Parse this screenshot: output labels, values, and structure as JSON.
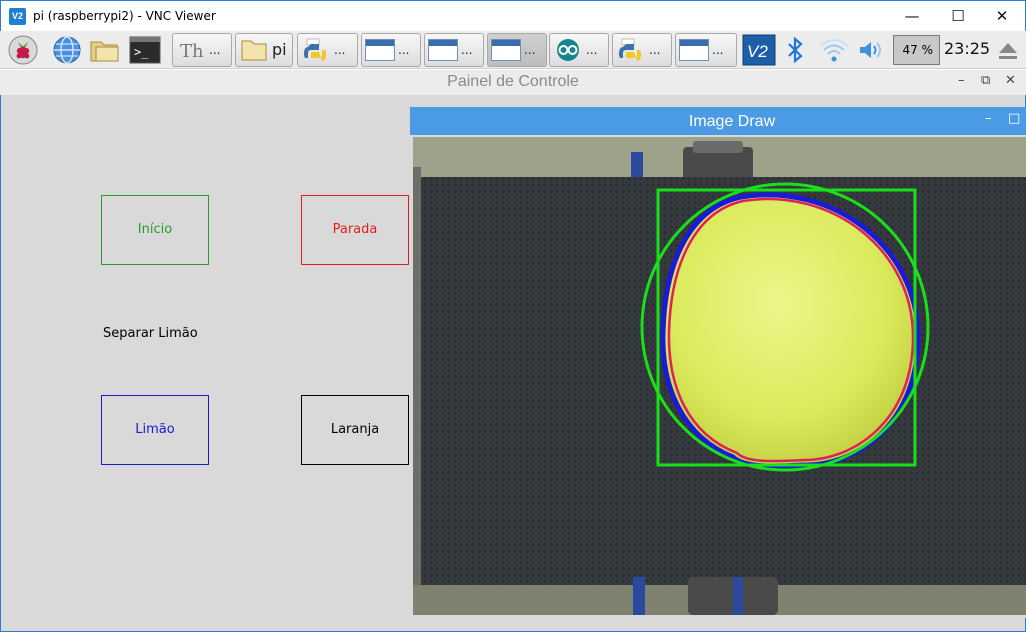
{
  "window": {
    "title": "pi (raspberrypi2) - VNC Viewer",
    "icon": "vnc-icon",
    "controls": {
      "minimize": "—",
      "maximize": "☐",
      "close": "✕"
    }
  },
  "taskbar": {
    "launchers": [
      "raspberry-menu-icon",
      "web-browser-icon",
      "file-manager-icon",
      "terminal-icon"
    ],
    "tasks": [
      {
        "icon": "thonny-icon",
        "label": "..."
      },
      {
        "icon": "folder-icon",
        "label": "pi"
      },
      {
        "icon": "python-icon",
        "label": "..."
      },
      {
        "icon": "window-icon",
        "label": "..."
      },
      {
        "icon": "window-icon",
        "label": "..."
      },
      {
        "icon": "window-icon",
        "label": "..."
      },
      {
        "icon": "arduino-icon",
        "label": "..."
      },
      {
        "icon": "python-icon",
        "label": "..."
      },
      {
        "icon": "window-icon",
        "label": "..."
      }
    ],
    "tray": {
      "icons": [
        "vnc-tray-icon",
        "bluetooth-icon",
        "wifi-icon",
        "volume-icon"
      ],
      "cpu_usage": "47 %",
      "clock": "23:25",
      "eject_icon": "eject-icon"
    }
  },
  "panel": {
    "title": "Painel de Controle",
    "controls": {
      "minimize": "–",
      "maximize": "⧉",
      "close": "✕"
    },
    "buttons": {
      "inicio": {
        "label": "Início",
        "color": "#2a9a2a"
      },
      "parada": {
        "label": "Parada",
        "color": "#e02020"
      },
      "limao": {
        "label": "Limão",
        "color": "#1a1ad0"
      },
      "laranja": {
        "label": "Laranja",
        "color": "#000000"
      }
    },
    "mode_label": "Separar Limão"
  },
  "image_window": {
    "title": "Image Draw",
    "controls": {
      "minimize": "–",
      "maximize": "□"
    },
    "overlay_colors": {
      "bounding_box": "#19e019",
      "enclosing_circle": "#19e019",
      "contour_outer": "#1a1ad8",
      "contour_inner": "#e0205a"
    },
    "accent": "#4a9ae6"
  }
}
